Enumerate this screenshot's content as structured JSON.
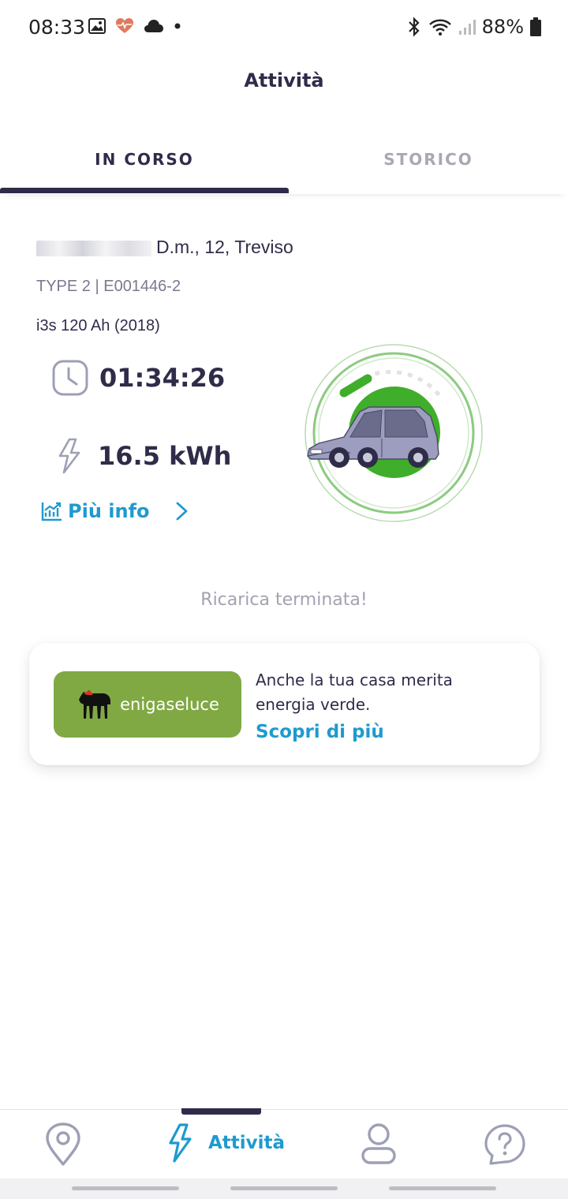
{
  "status_bar": {
    "time": "08:33",
    "battery": "88%"
  },
  "header": {
    "title": "Attività"
  },
  "tabs": [
    {
      "label": "IN CORSO",
      "active": true
    },
    {
      "label": "STORICO",
      "active": false
    }
  ],
  "session": {
    "address_visible": "D.m., 12, Treviso",
    "connector": "TYPE 2 | E001446-2",
    "vehicle": "i3s 120 Ah (2018)",
    "duration": "01:34:26",
    "energy": "16.5 kWh",
    "more_info_label": "Più info"
  },
  "status_message": "Ricarica terminata!",
  "promo": {
    "logo_text": "enigaseluce",
    "text": "Anche la tua casa merita energia verde.",
    "link_label": "Scopri di più"
  },
  "bottom_nav": {
    "items": [
      {
        "icon": "map-pin-icon",
        "active": false
      },
      {
        "icon": "lightning-icon",
        "label": "Attività",
        "active": true
      },
      {
        "icon": "user-icon",
        "active": false
      },
      {
        "icon": "help-icon",
        "active": false
      }
    ]
  },
  "colors": {
    "primary_dark": "#2f2c4a",
    "accent_blue": "#1e9ad0",
    "brand_green": "#80a944",
    "charge_green": "#3fae2a"
  }
}
